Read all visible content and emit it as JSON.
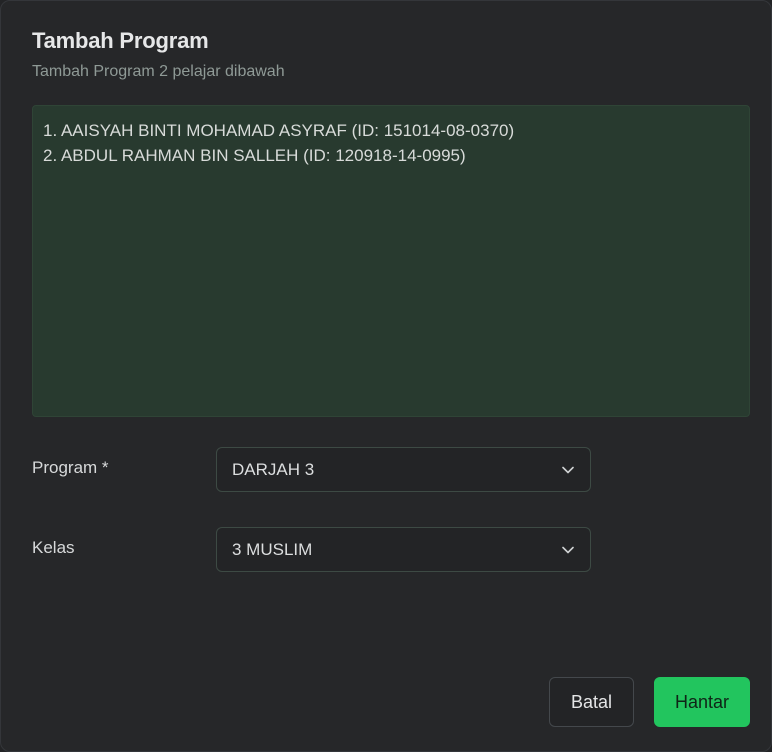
{
  "dialog": {
    "title": "Tambah Program",
    "subtitle": "Tambah Program 2 pelajar dibawah"
  },
  "students": [
    "1. AAISYAH BINTI MOHAMAD ASYRAF (ID: 151014-08-0370)",
    "2. ABDUL RAHMAN BIN SALLEH (ID: 120918-14-0995)"
  ],
  "form": {
    "program": {
      "label": "Program *",
      "value": "DARJAH 3"
    },
    "kelas": {
      "label": "Kelas",
      "value": "3 MUSLIM"
    }
  },
  "actions": {
    "cancel_label": "Batal",
    "submit_label": "Hantar"
  },
  "colors": {
    "accent": "#22c55e",
    "student_box_bg": "#283a2f",
    "background": "#262729"
  },
  "icons": {
    "select_chevron": "chevron-down-icon"
  }
}
